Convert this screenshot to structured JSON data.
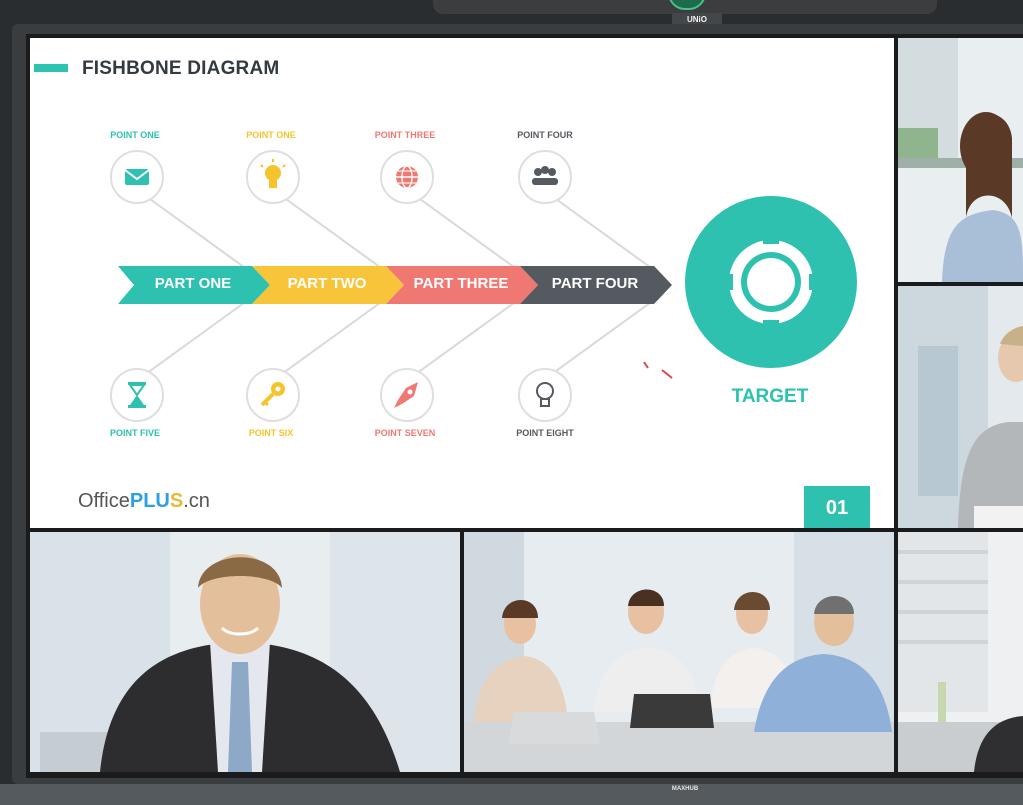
{
  "device": {
    "brand_top": "UNiO",
    "brand_bottom": "MAXHUB"
  },
  "slide": {
    "title": "FISHBONE DIAGRAM",
    "top_points": [
      {
        "label": "POINT ONE",
        "icon": "envelope-icon",
        "color": "#2ec1af"
      },
      {
        "label": "POINT ONE",
        "icon": "lightbulb-icon",
        "color": "#f5c42c"
      },
      {
        "label": "POINT THREE",
        "icon": "globe-icon",
        "color": "#f07873"
      },
      {
        "label": "POINT FOUR",
        "icon": "people-icon",
        "color": "#555a60"
      }
    ],
    "bottom_points": [
      {
        "label": "POINT FIVE",
        "icon": "hourglass-icon",
        "color": "#2ec1af"
      },
      {
        "label": "POINT SIX",
        "icon": "key-icon",
        "color": "#f5c42c"
      },
      {
        "label": "POINT SEVEN",
        "icon": "rocket-icon",
        "color": "#f07873"
      },
      {
        "label": "POINT EIGHT",
        "icon": "lightbulb-outline-icon",
        "color": "#555a60"
      }
    ],
    "parts": [
      {
        "label": "PART ONE",
        "color": "#2ec1af"
      },
      {
        "label": "PART TWO",
        "color": "#f7c43a"
      },
      {
        "label": "PART THREE",
        "color": "#f07873"
      },
      {
        "label": "PART FOUR",
        "color": "#555a60"
      }
    ],
    "target_label": "TARGET",
    "target_icon": "target-ring-icon",
    "logo": {
      "part1": "Office",
      "part2": "PLU",
      "part3": "S",
      "part4": ".cn"
    },
    "page_number": "01",
    "accent_color": "#2ec1af"
  },
  "participants": [
    {
      "name": "participant-top-right",
      "description_icon": "woman-video-feed"
    },
    {
      "name": "participant-middle-right",
      "description_icon": "man-video-feed"
    },
    {
      "name": "participant-bottom-left",
      "description_icon": "businessman-video-feed"
    },
    {
      "name": "participant-bottom-center",
      "description_icon": "team-video-feed"
    },
    {
      "name": "participant-bottom-right",
      "description_icon": "office-video-feed"
    }
  ]
}
